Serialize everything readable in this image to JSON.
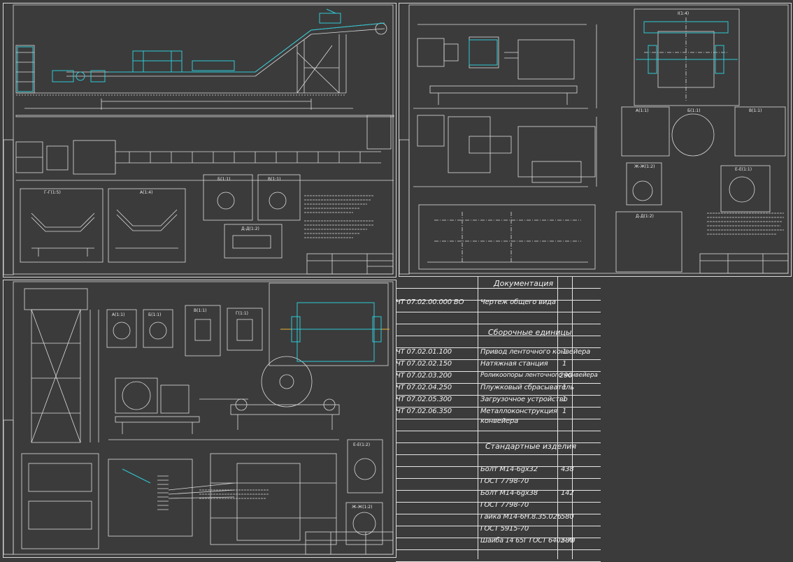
{
  "specification": {
    "sections": {
      "documentation": "Документация",
      "assemblies": "Сборочные единицы",
      "standard_parts": "Стандартные изделия"
    },
    "documentation": [
      {
        "code": "ЧТ 07.02.00.000 ВО",
        "name": "Чертеж общего вида",
        "qty": ""
      }
    ],
    "assemblies": [
      {
        "code": "ЧТ 07.02.01.100",
        "name": "Привод ленточного конвейера",
        "qty": "1"
      },
      {
        "code": "ЧТ 07.02.02.150",
        "name": "Натяжная станция",
        "qty": "1"
      },
      {
        "code": "ЧТ 07.02.03.200",
        "name": "Роликоопоры ленточного конвейера",
        "qty": "290"
      },
      {
        "code": "ЧТ 07.02.04.250",
        "name": "Плужковый сбрасыватель",
        "qty": "1"
      },
      {
        "code": "ЧТ 07.02.05.300",
        "name": "Загрузочное устройство",
        "qty": "1"
      },
      {
        "code": "ЧТ 07.02.06.350",
        "name": "Металлоконструкция",
        "name2": "конвейера",
        "qty": "1"
      }
    ],
    "standard_parts": [
      {
        "name": "Болт М14-6gх32",
        "qty": "438"
      },
      {
        "name": "ГОСТ 7798-70",
        "qty": ""
      },
      {
        "name": "Болт М14-6gх38",
        "qty": "142"
      },
      {
        "name": "ГОСТ 7798-70",
        "qty": ""
      },
      {
        "name": "Гайка М14-6Н.8.35.026",
        "qty": "580"
      },
      {
        "name": "ГОСТ 5915-70",
        "qty": ""
      },
      {
        "name": "Шайба 14 65Г ГОСТ 6402-70",
        "qty": "580"
      }
    ]
  },
  "view_labels": {
    "s1": [
      "Г-Г(1:5)",
      "А(1:4)",
      "Б(1:1)",
      "В(1:1)",
      "Д-Д(1:2)"
    ],
    "s2": [
      "А(1:1)",
      "Б(1:1)",
      "В(1:1)",
      "Ж-Ж(1:2)",
      "Е-Е(1:1)",
      "Д-Д(1:2)",
      "I(1:4)"
    ],
    "s3": [
      "А(1:1)",
      "Б(1:1)",
      "В(1:1)",
      "Г(1:1)",
      "Е-Е(1:2)",
      "Ж-Ж(1:2)"
    ]
  },
  "colors": {
    "background": "#3b3b3b",
    "lines": "#e0e0e0",
    "accent": "#2ec9d6"
  }
}
